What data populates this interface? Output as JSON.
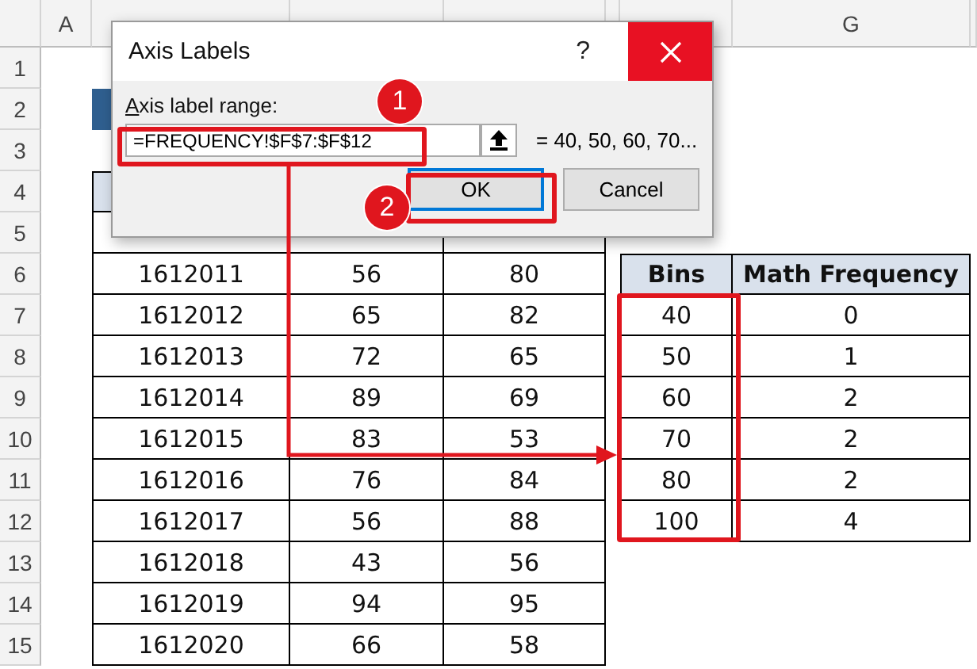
{
  "sheet": {
    "column_headers": [
      "A",
      "G"
    ],
    "row_numbers": [
      "1",
      "2",
      "3",
      "4",
      "5",
      "6",
      "7",
      "8",
      "9",
      "10",
      "11",
      "12",
      "13",
      "14",
      "15"
    ]
  },
  "data_table": {
    "rows": [
      {
        "id": "1612011",
        "col_2": "56",
        "col_3": "80"
      },
      {
        "id": "1612012",
        "col_2": "65",
        "col_3": "82"
      },
      {
        "id": "1612013",
        "col_2": "72",
        "col_3": "65"
      },
      {
        "id": "1612014",
        "col_2": "89",
        "col_3": "69"
      },
      {
        "id": "1612015",
        "col_2": "83",
        "col_3": "53"
      },
      {
        "id": "1612016",
        "col_2": "76",
        "col_3": "84"
      },
      {
        "id": "1612017",
        "col_2": "56",
        "col_3": "88"
      },
      {
        "id": "1612018",
        "col_2": "43",
        "col_3": "56"
      },
      {
        "id": "1612019",
        "col_2": "94",
        "col_3": "95"
      },
      {
        "id": "1612020",
        "col_2": "66",
        "col_3": "58"
      }
    ]
  },
  "bins_table": {
    "columns": [
      "Bins",
      "Math Frequency"
    ],
    "rows": [
      {
        "bin": "40",
        "frequency": "0"
      },
      {
        "bin": "50",
        "frequency": "1"
      },
      {
        "bin": "60",
        "frequency": "2"
      },
      {
        "bin": "70",
        "frequency": "2"
      },
      {
        "bin": "80",
        "frequency": "2"
      },
      {
        "bin": "100",
        "frequency": "4"
      }
    ]
  },
  "dialog": {
    "title": "Axis Labels",
    "help": "?",
    "field_label": "Axis label range:",
    "range_value": "=FREQUENCY!$F$7:$F$12",
    "preview": "= 40, 50, 60, 70...",
    "buttons": [
      {
        "label": "OK",
        "default": true
      },
      {
        "label": "Cancel",
        "default": false
      }
    ]
  },
  "callouts": [
    "1",
    "2"
  ]
}
